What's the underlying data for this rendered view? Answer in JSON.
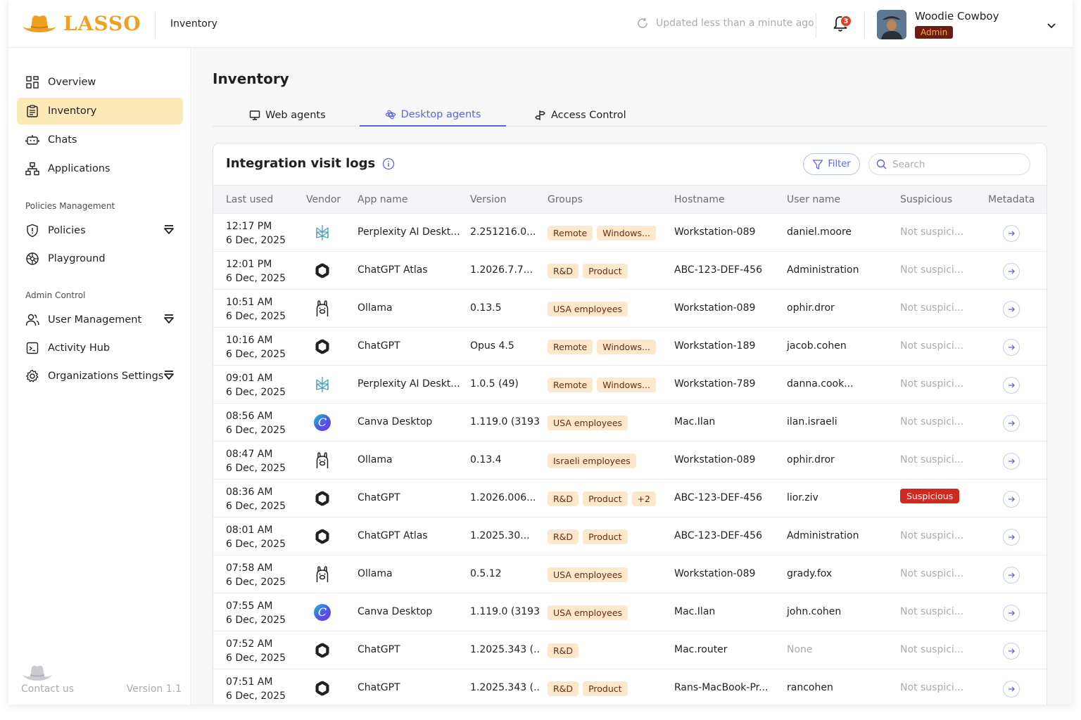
{
  "header": {
    "logo_text": "LASSO",
    "breadcrumb": "Inventory",
    "updated_text": "Updated less than a minute ago",
    "notifications_count": "3",
    "user_name": "Woodie Cowboy",
    "user_role": "Admin"
  },
  "sidebar": {
    "items_top": [
      {
        "label": "Overview",
        "icon": "overview-icon"
      },
      {
        "label": "Inventory",
        "icon": "inventory-icon",
        "active": true
      },
      {
        "label": "Chats",
        "icon": "chats-icon"
      },
      {
        "label": "Applications",
        "icon": "applications-icon"
      }
    ],
    "section_policies": "Policies Management",
    "items_policies": [
      {
        "label": "Policies",
        "icon": "shield-icon"
      },
      {
        "label": "Playground",
        "icon": "playground-icon"
      }
    ],
    "section_admin": "Admin Control",
    "items_admin": [
      {
        "label": "User Management",
        "icon": "users-icon"
      },
      {
        "label": "Activity Hub",
        "icon": "activity-icon"
      },
      {
        "label": "Organizations Settings",
        "icon": "gear-icon"
      }
    ],
    "contact_label": "Contact us",
    "version_label": "Version 1.1"
  },
  "main": {
    "title": "Inventory",
    "tabs": [
      {
        "label": "Web agents",
        "icon": "monitor-icon"
      },
      {
        "label": "Desktop agents",
        "icon": "desktop-agents-icon",
        "active": true
      },
      {
        "label": "Access Control",
        "icon": "access-control-icon"
      }
    ],
    "card_title": "Integration visit logs",
    "filter_label": "Filter",
    "search_placeholder": "Search",
    "columns": [
      "Last used",
      "Vendor",
      "App name",
      "Version",
      "Groups",
      "Hostname",
      "User name",
      "Suspicious",
      "Metadata"
    ],
    "rows": [
      {
        "time": "12:17 PM",
        "date": "6 Dec, 2025",
        "vendor": "perplexity",
        "app": "Perplexity AI Deskt...",
        "version": "2.251216.0...",
        "groups": [
          "Remote",
          "Windows..."
        ],
        "hostname": "Workstation-089",
        "user": "daniel.moore",
        "suspicious": "Not suspici...",
        "is_suspicious": false,
        "user_none": false
      },
      {
        "time": "12:01 PM",
        "date": "6 Dec, 2025",
        "vendor": "openai",
        "app": "ChatGPT Atlas",
        "version": "1.2026.7.7...",
        "groups": [
          "R&D",
          "Product"
        ],
        "hostname": "ABC-123-DEF-456",
        "user": "Administration",
        "suspicious": "Not suspici...",
        "is_suspicious": false,
        "user_none": false
      },
      {
        "time": "10:51 AM",
        "date": "6 Dec, 2025",
        "vendor": "ollama",
        "app": "Ollama",
        "version": "0.13.5",
        "groups": [
          "USA employees"
        ],
        "hostname": "Workstation-089",
        "user": "ophir.dror",
        "suspicious": "Not suspici...",
        "is_suspicious": false,
        "user_none": false
      },
      {
        "time": "10:16 AM",
        "date": "6 Dec, 2025",
        "vendor": "openai",
        "app": "ChatGPT",
        "version": "Opus 4.5",
        "groups": [
          "Remote",
          "Windows..."
        ],
        "hostname": "Workstation-189",
        "user": "jacob.cohen",
        "suspicious": "Not suspici...",
        "is_suspicious": false,
        "user_none": false
      },
      {
        "time": "09:01 AM",
        "date": "6 Dec, 2025",
        "vendor": "perplexity",
        "app": "Perplexity AI Deskt...",
        "version": "1.0.5 (49)",
        "groups": [
          "Remote",
          "Windows..."
        ],
        "hostname": "Workstation-789",
        "user": "danna.cook...",
        "suspicious": "Not suspici...",
        "is_suspicious": false,
        "user_none": false
      },
      {
        "time": "08:56 AM",
        "date": "6 Dec, 2025",
        "vendor": "canva",
        "app": "Canva Desktop",
        "version": "1.119.0 (3193...",
        "groups": [
          "USA employees"
        ],
        "hostname": "Mac.Ilan",
        "user": "ilan.israeli",
        "suspicious": "Not suspici...",
        "is_suspicious": false,
        "user_none": false
      },
      {
        "time": "08:47 AM",
        "date": "6 Dec, 2025",
        "vendor": "ollama",
        "app": "Ollama",
        "version": "0.13.4",
        "groups": [
          "Israeli employees"
        ],
        "hostname": "Workstation-089",
        "user": "ophir.dror",
        "suspicious": "Not suspici...",
        "is_suspicious": false,
        "user_none": false
      },
      {
        "time": "08:36 AM",
        "date": "6 Dec, 2025",
        "vendor": "openai",
        "app": "ChatGPT",
        "version": "1.2026.006...",
        "groups": [
          "R&D",
          "Product",
          "+2"
        ],
        "hostname": "ABC-123-DEF-456",
        "user": "lior.ziv",
        "suspicious": "Suspicious",
        "is_suspicious": true,
        "user_none": false
      },
      {
        "time": "08:01 AM",
        "date": "6 Dec, 2025",
        "vendor": "openai",
        "app": "ChatGPT Atlas",
        "version": "1.2025.30...",
        "groups": [
          "R&D",
          "Product"
        ],
        "hostname": "ABC-123-DEF-456",
        "user": "Administration",
        "suspicious": "Not suspici...",
        "is_suspicious": false,
        "user_none": false
      },
      {
        "time": "07:58 AM",
        "date": "6 Dec, 2025",
        "vendor": "ollama",
        "app": "Ollama",
        "version": "0.5.12",
        "groups": [
          "USA employees"
        ],
        "hostname": "Workstation-089",
        "user": "grady.fox",
        "suspicious": "Not suspici...",
        "is_suspicious": false,
        "user_none": false
      },
      {
        "time": "07:55 AM",
        "date": "6 Dec, 2025",
        "vendor": "canva",
        "app": "Canva Desktop",
        "version": "1.119.0 (3193...",
        "groups": [
          "USA employees"
        ],
        "hostname": "Mac.Ilan",
        "user": "john.cohen",
        "suspicious": "Not suspici...",
        "is_suspicious": false,
        "user_none": false
      },
      {
        "time": "07:52 AM",
        "date": "6 Dec, 2025",
        "vendor": "openai",
        "app": "ChatGPT",
        "version": "1.2025.343 (...",
        "groups": [
          "R&D"
        ],
        "hostname": "Mac.router",
        "user": "None",
        "suspicious": "Not suspici...",
        "is_suspicious": false,
        "user_none": true
      },
      {
        "time": "07:51 AM",
        "date": "6 Dec, 2025",
        "vendor": "openai",
        "app": "ChatGPT",
        "version": "1.2025.343 (...",
        "groups": [
          "R&D",
          "Product"
        ],
        "hostname": "Rans-MacBook-Pr...",
        "user": "rancohen",
        "suspicious": "Not suspici...",
        "is_suspicious": false,
        "user_none": false
      }
    ]
  },
  "colors": {
    "accent": "#5b67d8",
    "brand": "#f0a020",
    "active_nav": "#fde8b8",
    "tag_bg": "#fde8cc",
    "suspicious": "#cf2a1f"
  }
}
